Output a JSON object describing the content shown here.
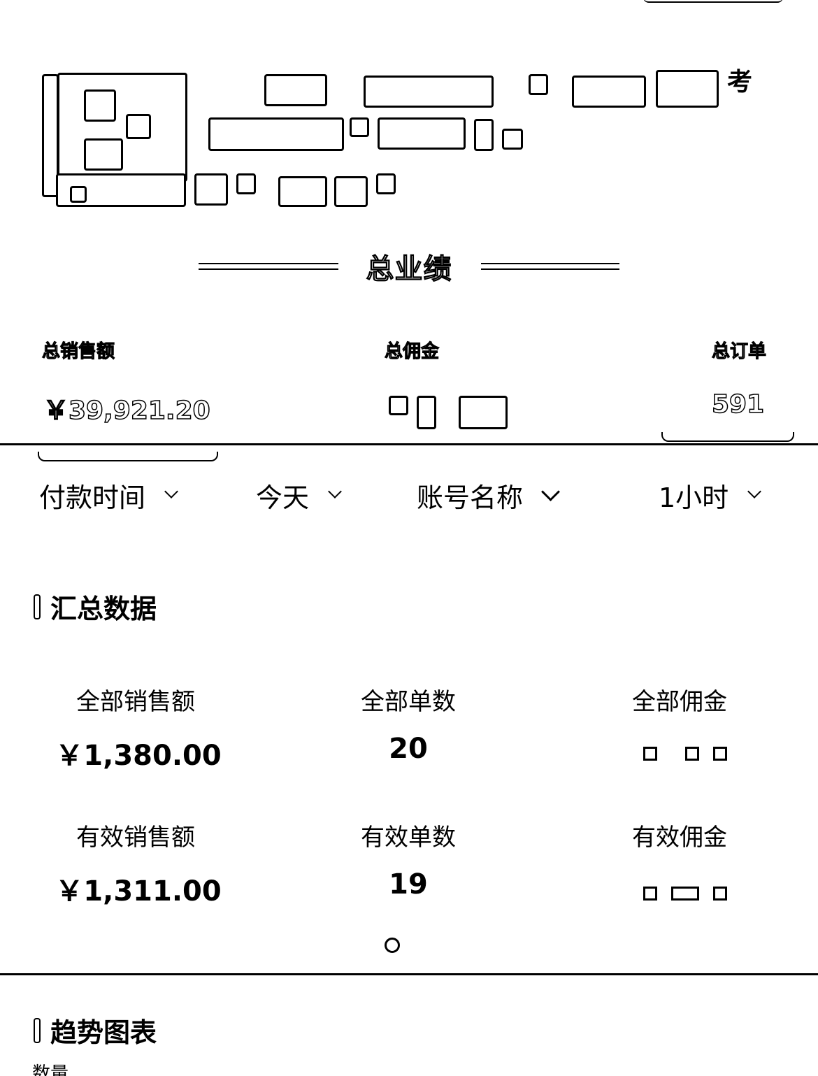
{
  "total_section": {
    "title": "总业绩",
    "sales_label": "总销售额",
    "sales_value": "￥39,921.20",
    "commission_label": "总佣金",
    "orders_label": "总订单",
    "orders_value": "591"
  },
  "header": {
    "trailing_glyph": "考"
  },
  "filters": {
    "pay_time": "付款时间",
    "date": "今天",
    "account": "账号名称",
    "interval": "1小时"
  },
  "summary": {
    "title": "汇总数据",
    "all_sales_label": "全部销售额",
    "all_sales_value": "￥1,380.00",
    "all_orders_label": "全部单数",
    "all_orders_value": "20",
    "all_commission_label": "全部佣金",
    "valid_sales_label": "有效销售额",
    "valid_sales_value": "￥1,311.00",
    "valid_orders_label": "有效单数",
    "valid_orders_value": "19",
    "valid_commission_label": "有效佣金"
  },
  "trend": {
    "title": "趋势图表",
    "cut_label": "数量"
  },
  "icons": {
    "filter_chevron": "chevron-down-icon",
    "pager": "page-indicator-icon"
  }
}
